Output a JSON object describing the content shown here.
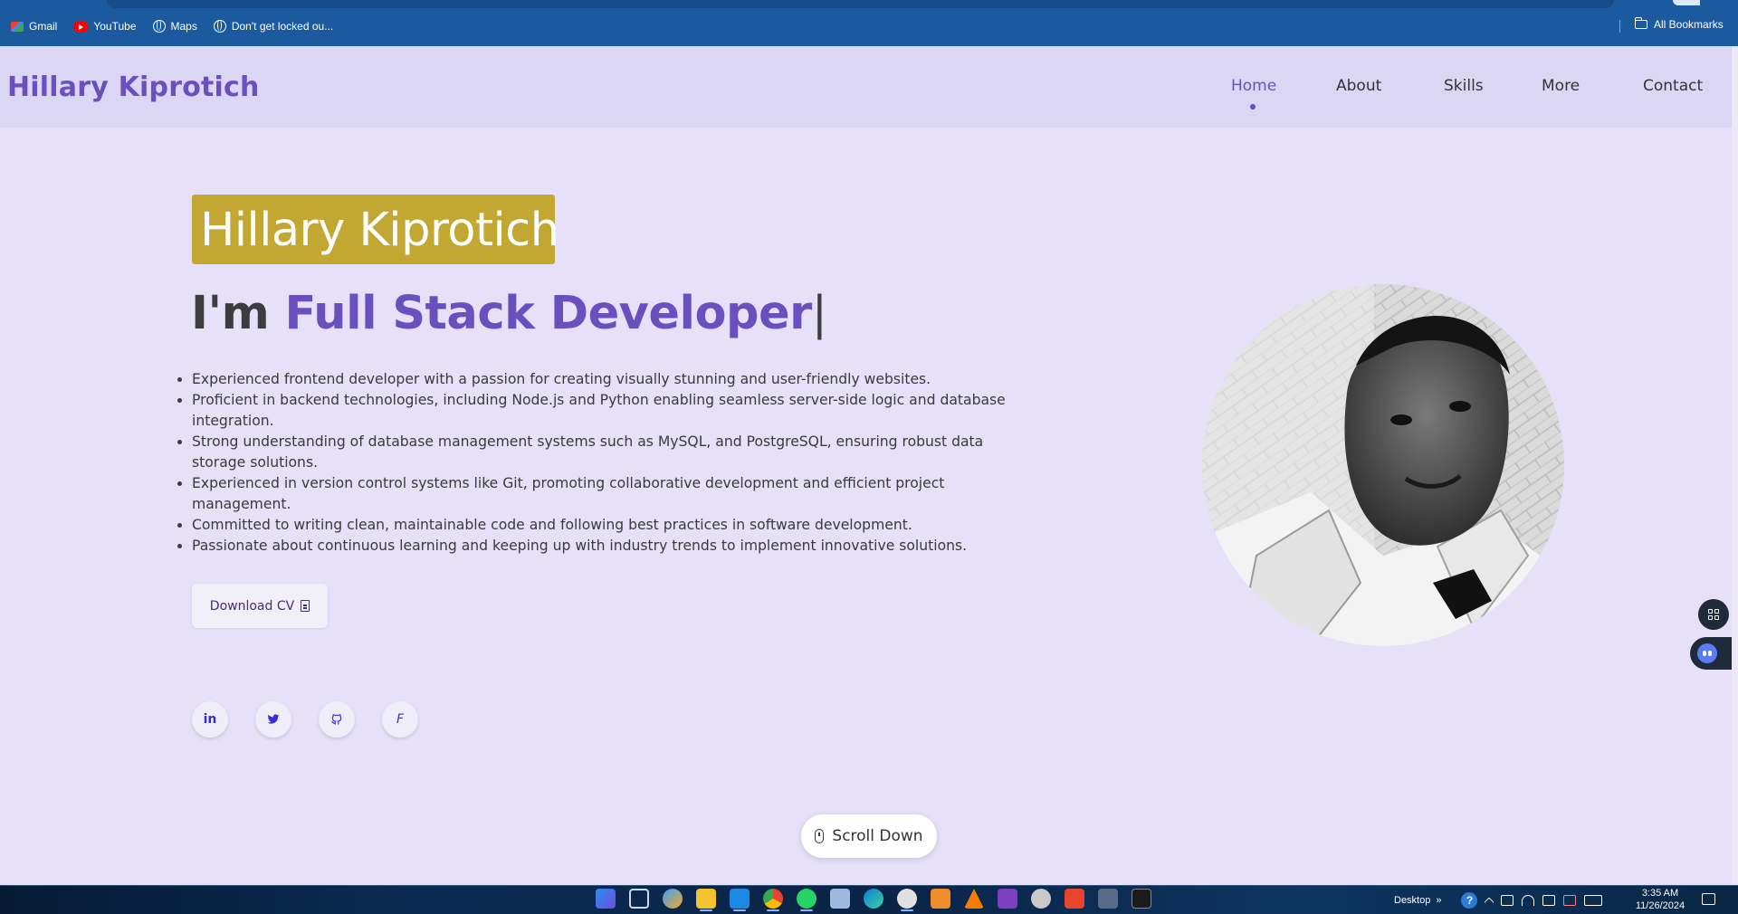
{
  "browser": {
    "bookmarks": [
      {
        "label": "Gmail",
        "icon": "gmail-icon"
      },
      {
        "label": "YouTube",
        "icon": "youtube-icon"
      },
      {
        "label": "Maps",
        "icon": "globe-icon"
      },
      {
        "label": "Don't get locked ou...",
        "icon": "globe-icon"
      }
    ],
    "all_bookmarks_label": "All Bookmarks",
    "chrome_color": "#1c5aa0"
  },
  "header": {
    "logo": "Hillary Kiprotich",
    "nav": [
      {
        "label": "Home",
        "active": true
      },
      {
        "label": "About",
        "active": false
      },
      {
        "label": "Skills",
        "active": false
      },
      {
        "label": "More",
        "active": false
      },
      {
        "label": "Contact",
        "active": false
      }
    ]
  },
  "hero": {
    "name": "Hillary Kiprotich",
    "role_prefix": "I'm ",
    "role": "Full Stack Developer",
    "cursor": "|",
    "bullets": [
      "Experienced frontend developer with a passion for creating visually stunning and user-friendly websites.",
      "Proficient in backend technologies, including Node.js and Python enabling seamless server-side logic and database integration.",
      "Strong understanding of database management systems such as MySQL, and PostgreSQL, ensuring robust data storage solutions.",
      "Experienced in version control systems like Git, promoting collaborative development and efficient project management.",
      "Committed to writing clean, maintainable code and following best practices in software development.",
      "Passionate about continuous learning and keeping up with industry trends to implement innovative solutions."
    ],
    "download_cv": "Download CV",
    "social": [
      {
        "name": "linkedin-icon",
        "glyph": "in"
      },
      {
        "name": "twitter-icon",
        "glyph": "🐦"
      },
      {
        "name": "github-icon",
        "glyph": "⌥"
      },
      {
        "name": "facebook-icon",
        "glyph": "F"
      }
    ],
    "scroll_down": "Scroll Down"
  },
  "colors": {
    "accent": "#6a4fbf",
    "badge": "#c2a732",
    "page_bg": "#e6e0f8",
    "header_bg": "#dcd6f5"
  },
  "taskbar": {
    "tray_label": "Desktop",
    "tray_chevron": "»",
    "help_glyph": "?",
    "time": "3:35 AM",
    "date": "11/26/2024"
  }
}
